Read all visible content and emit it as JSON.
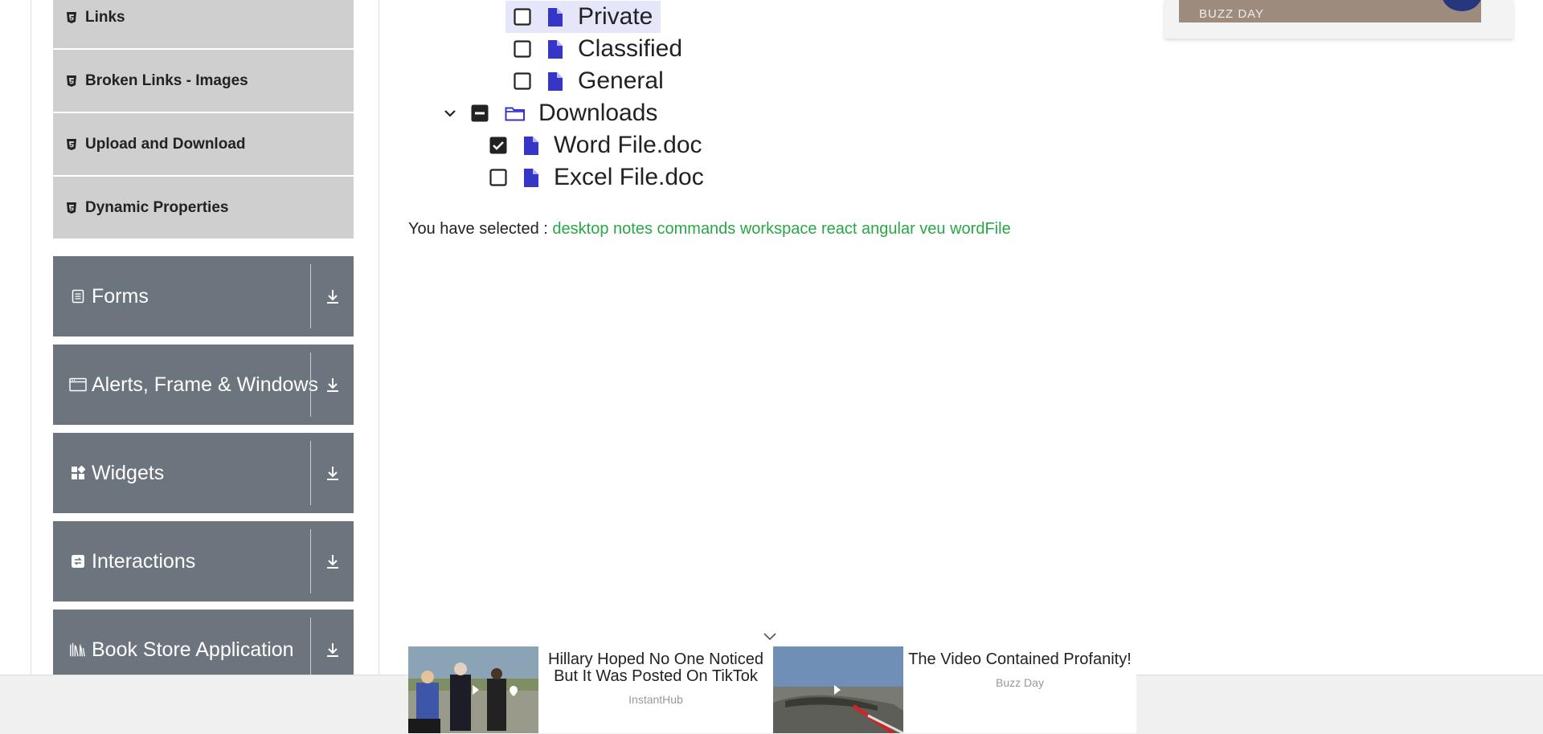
{
  "sidebar": {
    "sub_items": [
      {
        "label": "Links"
      },
      {
        "label": "Broken Links - Images"
      },
      {
        "label": "Upload and Download"
      },
      {
        "label": "Dynamic Properties"
      }
    ],
    "groups": [
      {
        "label": "Forms",
        "icon": "forms-icon"
      },
      {
        "label": "Alerts, Frame & Windows",
        "icon": "window-icon"
      },
      {
        "label": "Widgets",
        "icon": "widgets-icon"
      },
      {
        "label": "Interactions",
        "icon": "interactions-icon"
      },
      {
        "label": "Book Store Application",
        "icon": "books-icon"
      }
    ]
  },
  "tree": {
    "nodes": [
      {
        "label": "Private",
        "checked": false,
        "highlighted": true
      },
      {
        "label": "Classified",
        "checked": false
      },
      {
        "label": "General",
        "checked": false
      },
      {
        "label": "Downloads",
        "checked": "partial",
        "expanded": true
      },
      {
        "label": "Word File.doc",
        "checked": true
      },
      {
        "label": "Excel File.doc",
        "checked": false
      }
    ]
  },
  "result": {
    "prefix": "You have selected :",
    "selected": "desktop notes commands workspace react angular veu wordFile"
  },
  "ads": {
    "top_brand": "BUZZ DAY",
    "bottom": [
      {
        "headline": "Hillary Hoped No One Noticed But It Was Posted On TikTok",
        "source": "InstantHub"
      },
      {
        "headline": "The Video Contained Profanity!",
        "source": "Buzz Day"
      }
    ]
  },
  "colors": {
    "sidebar_group_bg": "#6c757d",
    "sidebar_sub_bg": "#cfcfcf",
    "file_icon": "#3535c8",
    "selected_text": "#28a745"
  }
}
